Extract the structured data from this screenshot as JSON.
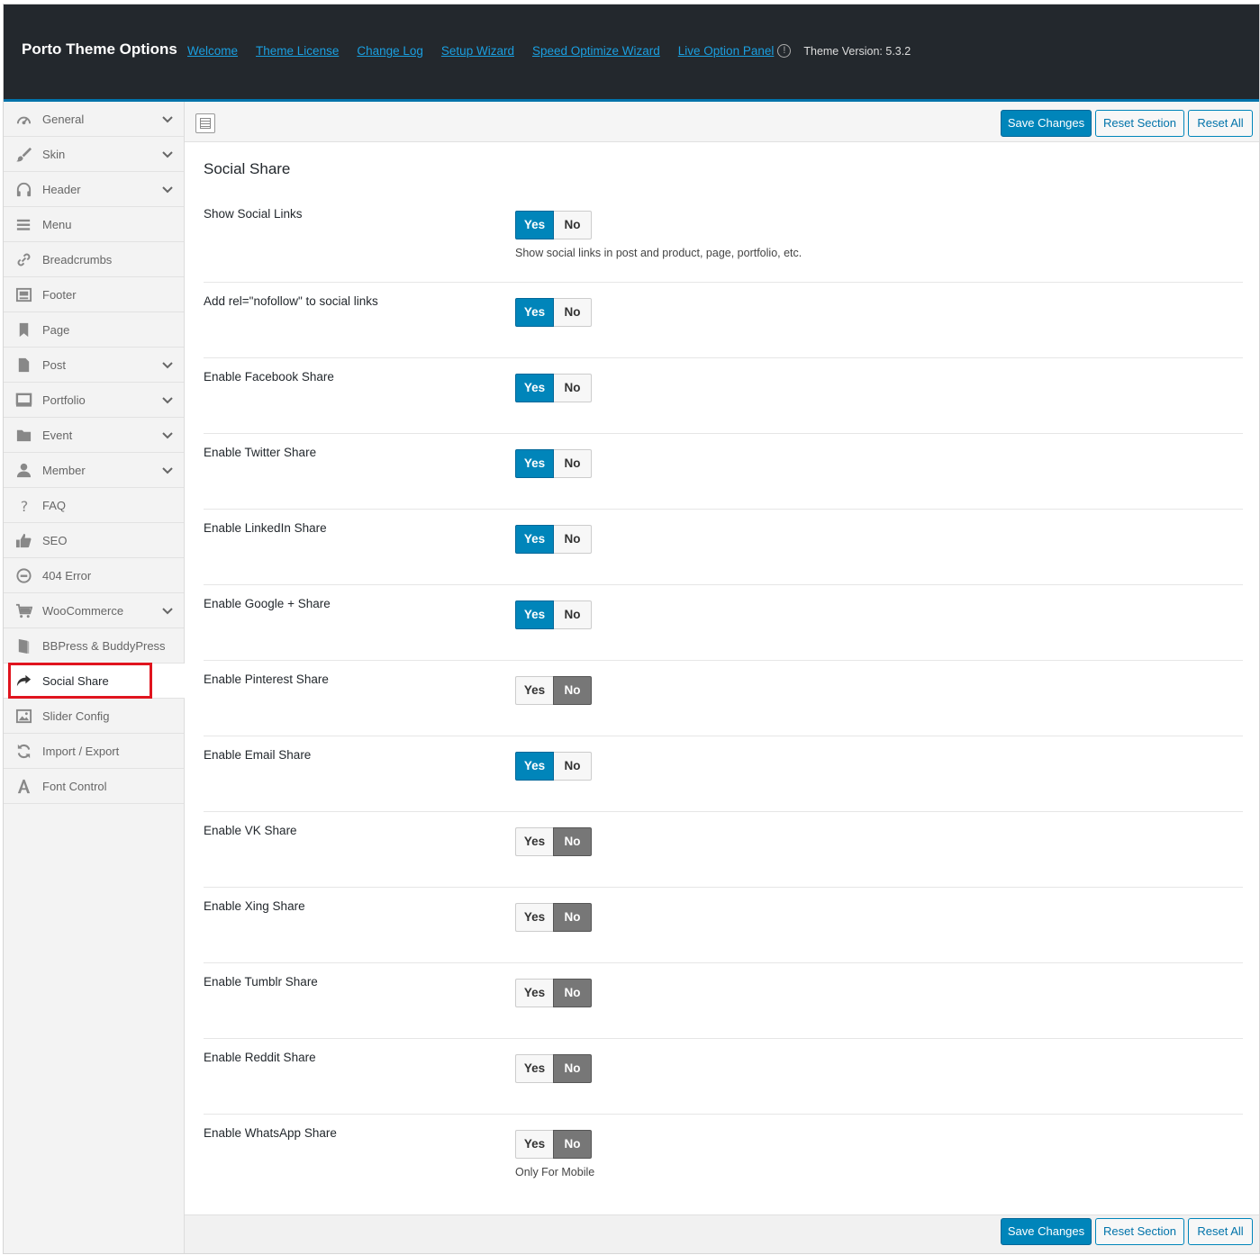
{
  "header": {
    "title": "Porto Theme Options",
    "links": [
      "Welcome",
      "Theme License",
      "Change Log",
      "Setup Wizard",
      "Speed Optimize Wizard",
      "Live Option Panel"
    ],
    "version": "Theme Version: 5.3.2"
  },
  "sidebar": {
    "items": [
      {
        "label": "General",
        "icon": "dashboard-icon",
        "has_submenu": true
      },
      {
        "label": "Skin",
        "icon": "brush-icon",
        "has_submenu": true
      },
      {
        "label": "Header",
        "icon": "headphones-icon",
        "has_submenu": true
      },
      {
        "label": "Menu",
        "icon": "menu-icon",
        "has_submenu": false
      },
      {
        "label": "Breadcrumbs",
        "icon": "link-icon",
        "has_submenu": false
      },
      {
        "label": "Footer",
        "icon": "footer-icon",
        "has_submenu": false
      },
      {
        "label": "Page",
        "icon": "bookmark-icon",
        "has_submenu": false
      },
      {
        "label": "Post",
        "icon": "document-icon",
        "has_submenu": true
      },
      {
        "label": "Portfolio",
        "icon": "monitor-icon",
        "has_submenu": true
      },
      {
        "label": "Event",
        "icon": "folder-icon",
        "has_submenu": true
      },
      {
        "label": "Member",
        "icon": "user-icon",
        "has_submenu": true
      },
      {
        "label": "FAQ",
        "icon": "question-icon",
        "has_submenu": false
      },
      {
        "label": "SEO",
        "icon": "thumbs-up-icon",
        "has_submenu": false
      },
      {
        "label": "404 Error",
        "icon": "minus-circle-icon",
        "has_submenu": false
      },
      {
        "label": "WooCommerce",
        "icon": "cart-icon",
        "has_submenu": true
      },
      {
        "label": "BBPress & BuddyPress",
        "icon": "book-icon",
        "has_submenu": false
      },
      {
        "label": "Social Share",
        "icon": "share-icon",
        "has_submenu": false,
        "active": true
      },
      {
        "label": "Slider Config",
        "icon": "image-icon",
        "has_submenu": false
      },
      {
        "label": "Import / Export",
        "icon": "refresh-icon",
        "has_submenu": false
      },
      {
        "label": "Font Control",
        "icon": "font-icon",
        "has_submenu": false
      }
    ]
  },
  "toolbar": {
    "save_label": "Save Changes",
    "reset_section_label": "Reset Section",
    "reset_all_label": "Reset All"
  },
  "section": {
    "title": "Social Share",
    "yes_label": "Yes",
    "no_label": "No",
    "options": [
      {
        "label": "Show Social Links",
        "value": "Yes",
        "desc": "Show social links in post and product, page, portfolio, etc."
      },
      {
        "label": "Add rel=\"nofollow\" to social links",
        "value": "Yes",
        "desc": ""
      },
      {
        "label": "Enable Facebook Share",
        "value": "Yes",
        "desc": ""
      },
      {
        "label": "Enable Twitter Share",
        "value": "Yes",
        "desc": ""
      },
      {
        "label": "Enable LinkedIn Share",
        "value": "Yes",
        "desc": ""
      },
      {
        "label": "Enable Google + Share",
        "value": "Yes",
        "desc": ""
      },
      {
        "label": "Enable Pinterest Share",
        "value": "No",
        "desc": ""
      },
      {
        "label": "Enable Email Share",
        "value": "Yes",
        "desc": ""
      },
      {
        "label": "Enable VK Share",
        "value": "No",
        "desc": ""
      },
      {
        "label": "Enable Xing Share",
        "value": "No",
        "desc": ""
      },
      {
        "label": "Enable Tumblr Share",
        "value": "No",
        "desc": ""
      },
      {
        "label": "Enable Reddit Share",
        "value": "No",
        "desc": ""
      },
      {
        "label": "Enable WhatsApp Share",
        "value": "No",
        "desc": "Only For Mobile"
      }
    ]
  },
  "colors": {
    "topbar": "#23282d",
    "accent": "#0085ba",
    "active_outline": "#e0141e",
    "switch_off": "#777777"
  }
}
